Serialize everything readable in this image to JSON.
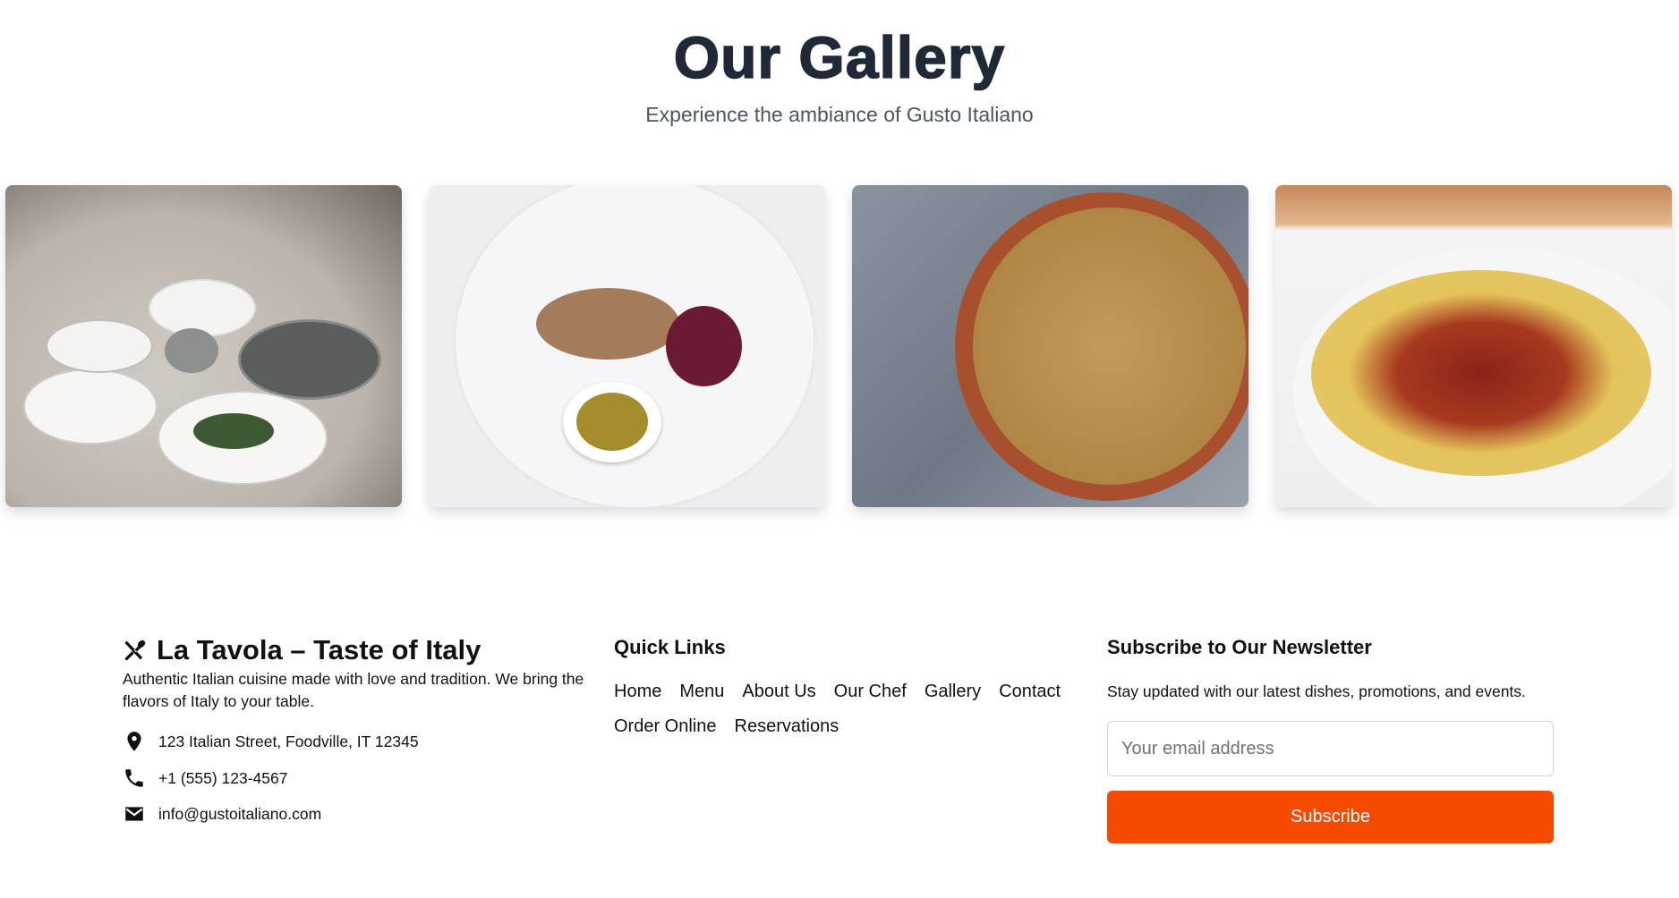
{
  "gallery": {
    "title": "Our Gallery",
    "subtitle": "Experience the ambiance of Gusto Italiano",
    "images": [
      "dining-table-image",
      "plated-dish-image",
      "spaghetti-bowl-image",
      "tortellini-plate-image"
    ]
  },
  "footer": {
    "brand": {
      "icon": "utensils-icon",
      "name": "La Tavola – Taste of Italy"
    },
    "description": "Authentic Italian cuisine made with love and tradition. We bring the flavors of Italy to your table.",
    "contact": {
      "address": "123 Italian Street, Foodville, IT 12345",
      "phone": "+1 (555) 123-4567",
      "email": "info@gustoitaliano.com"
    },
    "quick_links": {
      "title": "Quick Links",
      "items": [
        "Home",
        "Menu",
        "About Us",
        "Our Chef",
        "Gallery",
        "Contact",
        "Order Online",
        "Reservations"
      ]
    },
    "newsletter": {
      "title": "Subscribe to Our Newsletter",
      "description": "Stay updated with our latest dishes, promotions, and events.",
      "placeholder": "Your email address",
      "button": "Subscribe"
    }
  },
  "colors": {
    "accent": "#f54a00",
    "heading": "#1f2937",
    "subtitle": "#4b5563"
  }
}
